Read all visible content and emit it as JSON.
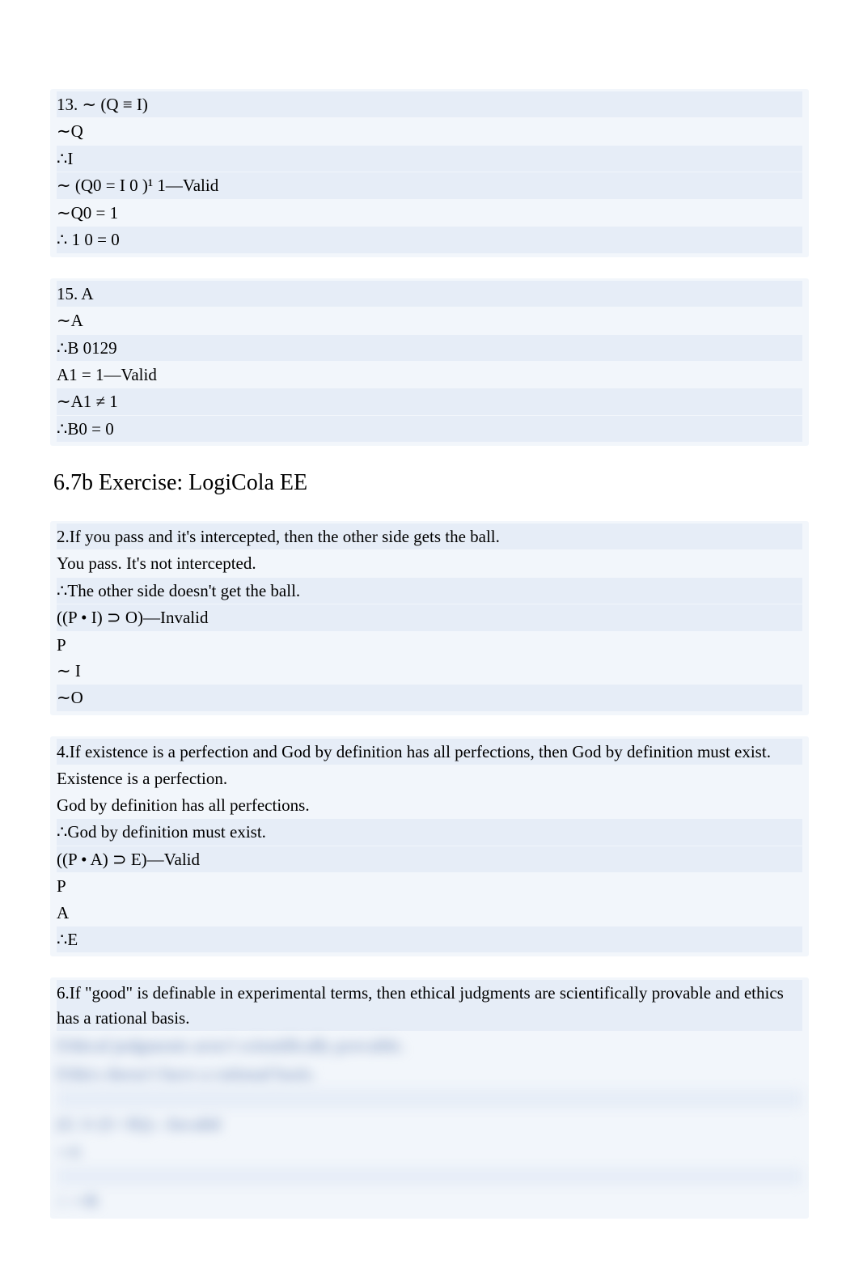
{
  "p13": {
    "l1": "13. ∼ (Q ≡ I)",
    "l2": " ∼Q",
    "l3": "∴I",
    "l4": "∼ (Q0 = I 0 )¹ 1—Valid",
    "l5": "  ∼Q0 = 1",
    "l6": "   ∴  1 0 = 0"
  },
  "p15": {
    "l1": "15. A",
    "l2": "∼A",
    "l3": " ∴B 0129",
    "l4": "A1 = 1—Valid",
    "l5": " ∼A1 ≠ 1",
    "l6": "  ∴B0 = 0"
  },
  "section_title": "6.7b Exercise: LogiCola EE",
  "p2": {
    "l1": "2.If you pass and it's intercepted, then the other side gets the ball.",
    "l2": " You pass. It's not intercepted.",
    "l3": " ∴The other side doesn't get the ball.",
    "l4": "((P • I)  ⊃ O)—Invalid",
    "l5": " P",
    "l6": " ∼ I",
    "l7": "∼O"
  },
  "p4": {
    "l1": "4.If existence is a perfection and God by definition has all perfections, then God by definition must exist.",
    "l2": " Existence is a perfection.",
    "l3": " God by definition has all perfections.",
    "l4": " ∴God by definition must exist.",
    "l5": "((P • A) ⊃  E)—Valid",
    "l6": "P",
    "l7": "A",
    "l8": "∴E"
  },
  "p6": {
    "l1": "6.If \"good\" is definable in experimental terms, then ethical judgments are scientifically provable and ethics has a rational basis.",
    "b1": "Ethical judgments aren't scientifically provable.",
    "b2": "   Ethics doesn't have a rational basis.",
    "b3": "(G ⊃ (S • R))—Invalid",
    "b4": " ∼S",
    "b5": "∴ ∼R"
  }
}
